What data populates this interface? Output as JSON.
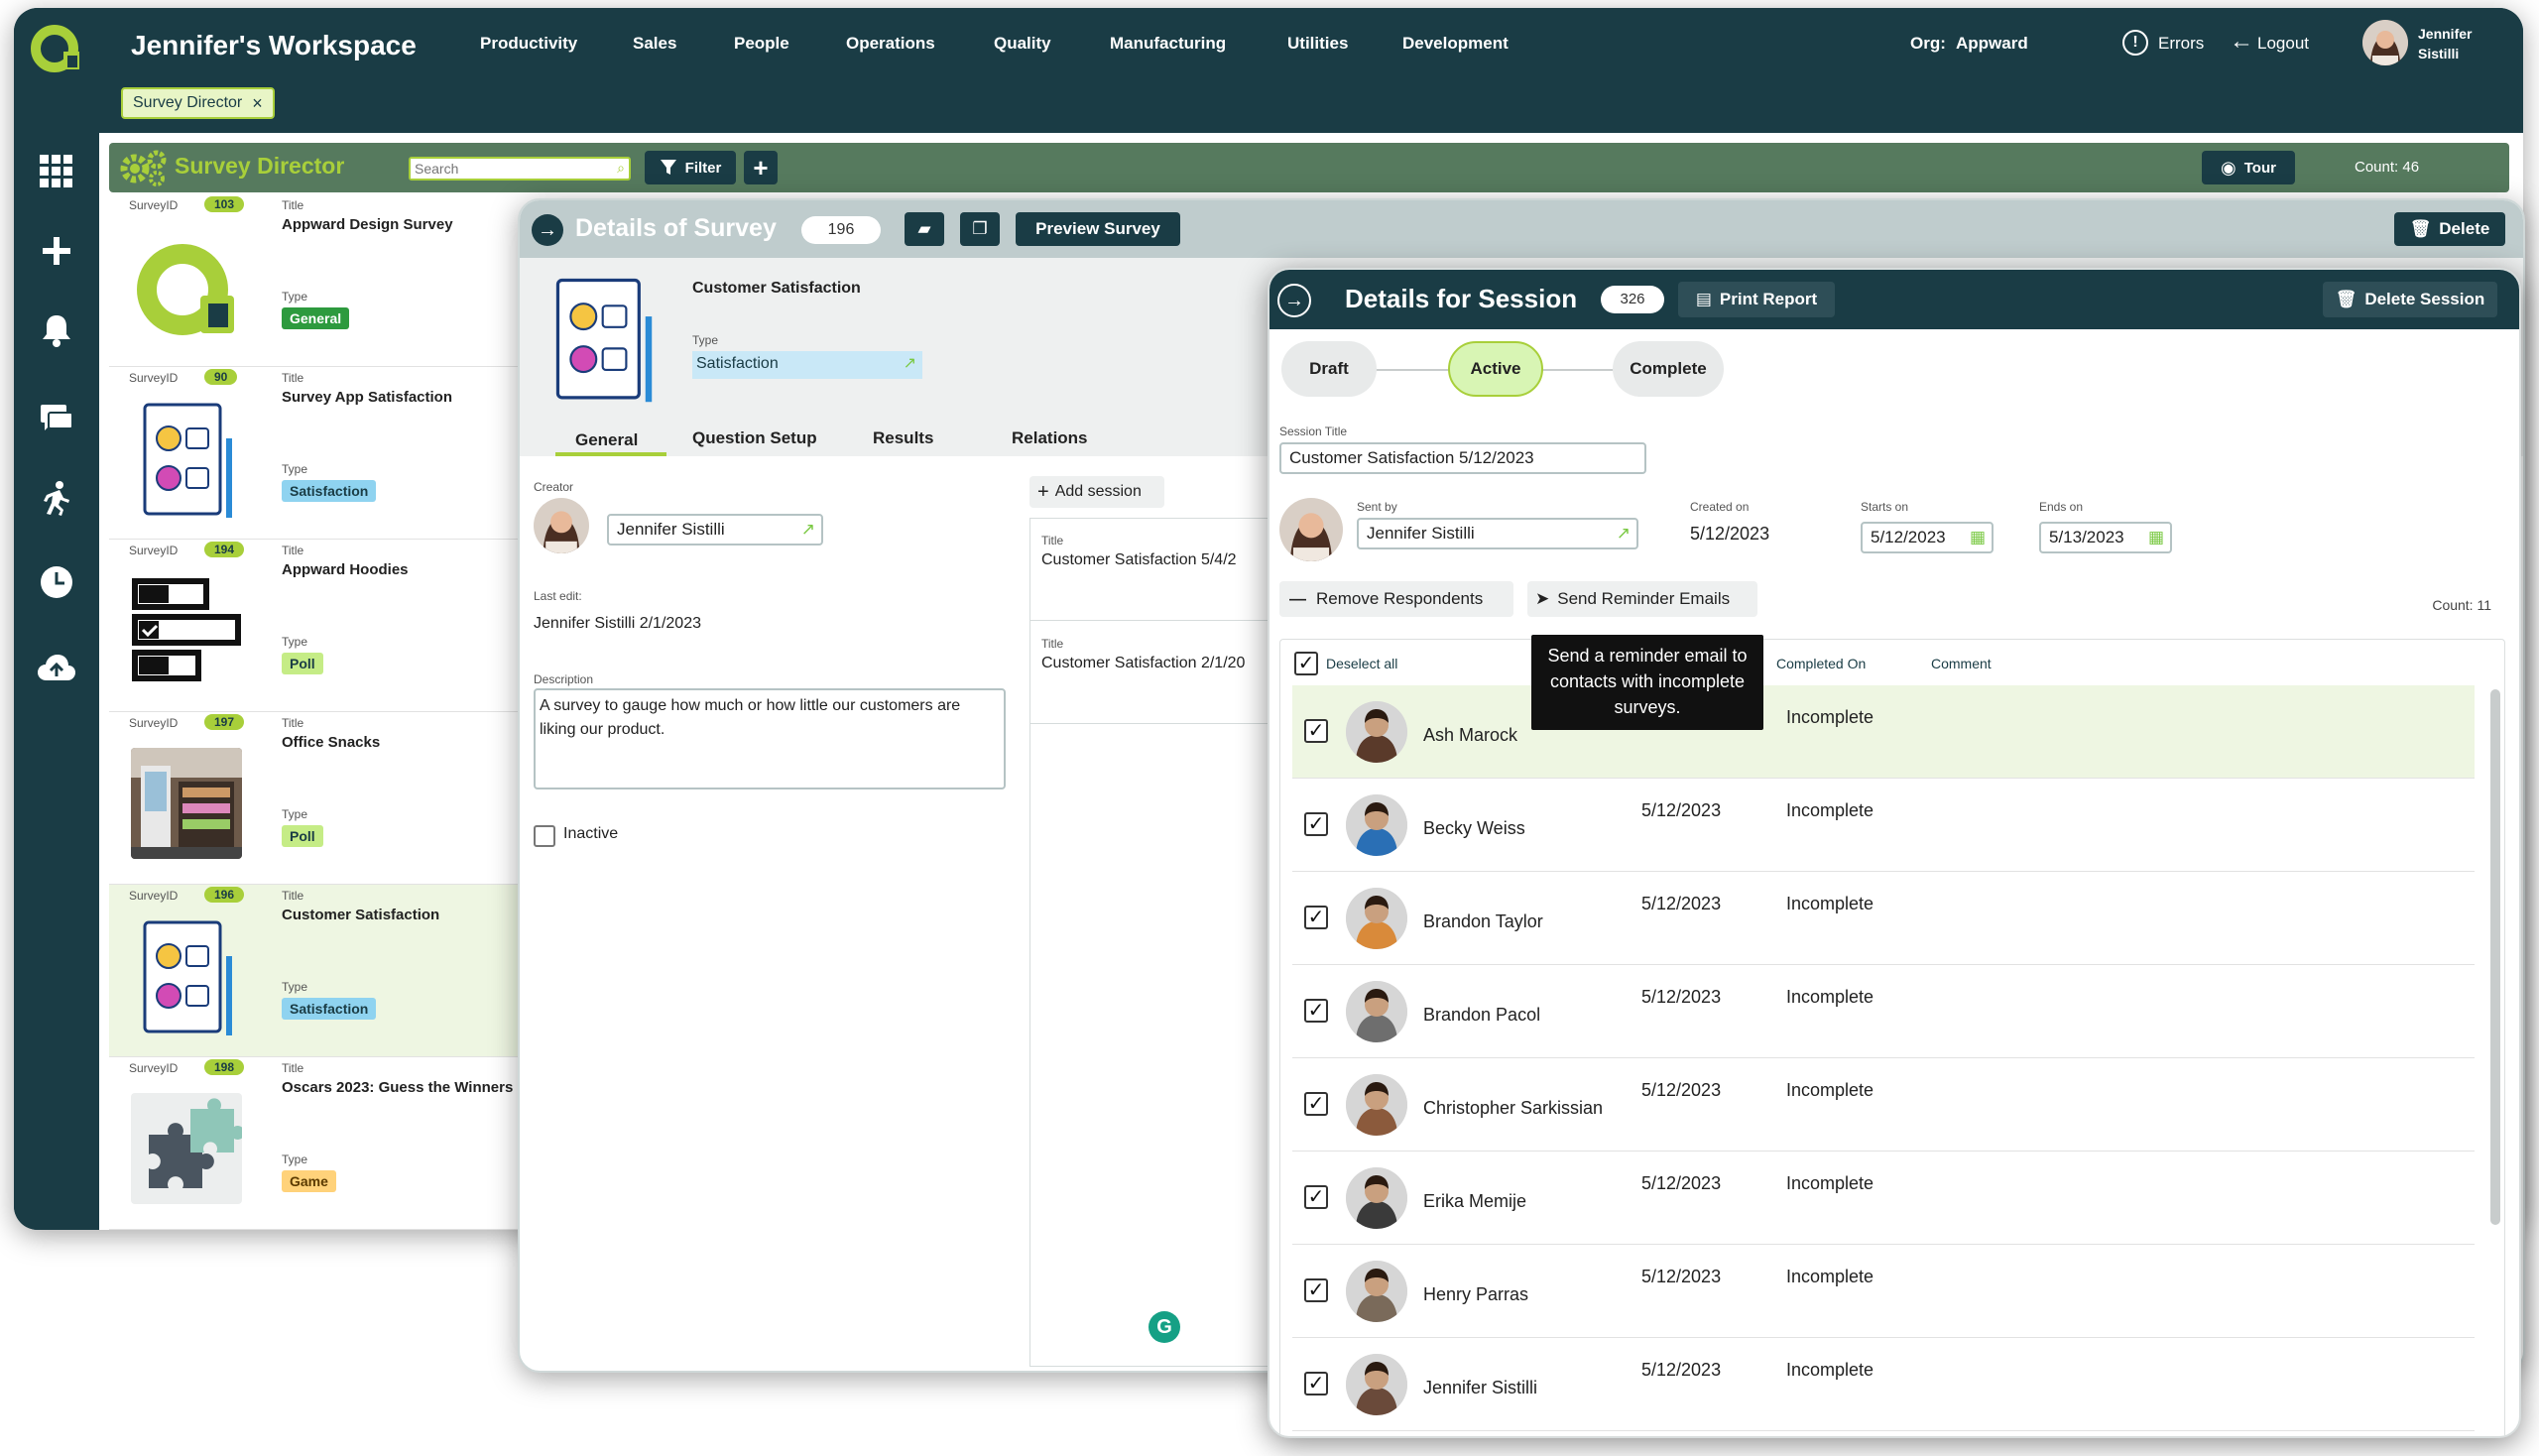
{
  "workspace": {
    "title": "Jennifer's Workspace",
    "nav": [
      "Productivity",
      "Sales",
      "People",
      "Operations",
      "Quality",
      "Manufacturing",
      "Utilities",
      "Development"
    ],
    "org_label": "Org:",
    "org_value": "Appward",
    "errors": "Errors",
    "logout": "Logout",
    "user_first": "Jennifer",
    "user_last": "Sistilli",
    "open_tab": "Survey Director",
    "tab_close": "×"
  },
  "director": {
    "title": "Survey Director",
    "search_placeholder": "Search",
    "filter": "Filter",
    "tour": "Tour",
    "count": "Count: 46"
  },
  "labels": {
    "survey_id": "SurveyID",
    "title": "Title",
    "type": "Type"
  },
  "surveys": [
    {
      "id": "103",
      "title": "Appward Design Survey",
      "type": "General",
      "type_color": "#2d9a3e"
    },
    {
      "id": "90",
      "title": "Survey App Satisfaction",
      "type": "Satisfaction",
      "type_color": "#8fd3f0"
    },
    {
      "id": "194",
      "title": "Appward Hoodies",
      "type": "Poll",
      "type_color": "#c5ec86"
    },
    {
      "id": "197",
      "title": "Office Snacks",
      "type": "Poll",
      "type_color": "#c5ec86"
    },
    {
      "id": "196",
      "title": "Customer Satisfaction",
      "type": "Satisfaction",
      "type_color": "#8fd3f0"
    },
    {
      "id": "198",
      "title": "Oscars 2023: Guess the Winners",
      "type": "Game",
      "type_color": "#ffd27a"
    }
  ],
  "survey_details": {
    "header": "Details of Survey",
    "id": "196",
    "preview": "Preview Survey",
    "delete": "Delete",
    "name": "Customer Satisfaction",
    "type_label": "Type",
    "type_value": "Satisfaction",
    "tabs": [
      "General",
      "Question Setup",
      "Results",
      "Relations"
    ],
    "creator_label": "Creator",
    "creator": "Jennifer Sistilli",
    "last_edit_label": "Last edit:",
    "last_edit": "Jennifer Sistilli 2/1/2023",
    "description_label": "Description",
    "description": "A survey to gauge how much or how little our customers are liking our product.",
    "inactive": "Inactive",
    "add_session": "Add session",
    "sessions": [
      {
        "label": "Title",
        "title": "Customer Satisfaction 5/4/2"
      },
      {
        "label": "Title",
        "title": "Customer Satisfaction 2/1/20"
      }
    ]
  },
  "session": {
    "header": "Details for Session",
    "id": "326",
    "print": "Print Report",
    "delete": "Delete Session",
    "steps": [
      "Draft",
      "Active",
      "Complete"
    ],
    "title_label": "Session Title",
    "title_value": "Customer Satisfaction 5/12/2023",
    "sent_by_label": "Sent by",
    "sent_by": "Jennifer Sistilli",
    "created_label": "Created on",
    "created": "5/12/2023",
    "starts_label": "Starts on",
    "starts": "5/12/2023",
    "ends_label": "Ends on",
    "ends": "5/13/2023",
    "remove": "Remove Respondents",
    "reminder": "Send Reminder Emails",
    "tooltip": "Send a reminder email to contacts with incomplete surveys.",
    "count": "Count: 11",
    "cols": {
      "deselect": "Deselect all",
      "completed": "Completed On",
      "comment": "Comment"
    }
  },
  "respondents": [
    {
      "name": "Ash Marock",
      "date": "",
      "status": "Incomplete",
      "color": "#5a3a2a"
    },
    {
      "name": "Becky Weiss",
      "date": "5/12/2023",
      "status": "Incomplete",
      "color": "#2a6fb5"
    },
    {
      "name": "Brandon Taylor",
      "date": "5/12/2023",
      "status": "Incomplete",
      "color": "#d98a3a"
    },
    {
      "name": "Brandon Pacol",
      "date": "5/12/2023",
      "status": "Incomplete",
      "color": "#6e6e6e"
    },
    {
      "name": "Christopher Sarkissian",
      "date": "5/12/2023",
      "status": "Incomplete",
      "color": "#8b5a3c"
    },
    {
      "name": "Erika Memije",
      "date": "5/12/2023",
      "status": "Incomplete",
      "color": "#3a3a3a"
    },
    {
      "name": "Henry Parras",
      "date": "5/12/2023",
      "status": "Incomplete",
      "color": "#7a6a5a"
    },
    {
      "name": "Jennifer Sistilli",
      "date": "5/12/2023",
      "status": "Incomplete",
      "color": "#6a4a3a"
    }
  ]
}
